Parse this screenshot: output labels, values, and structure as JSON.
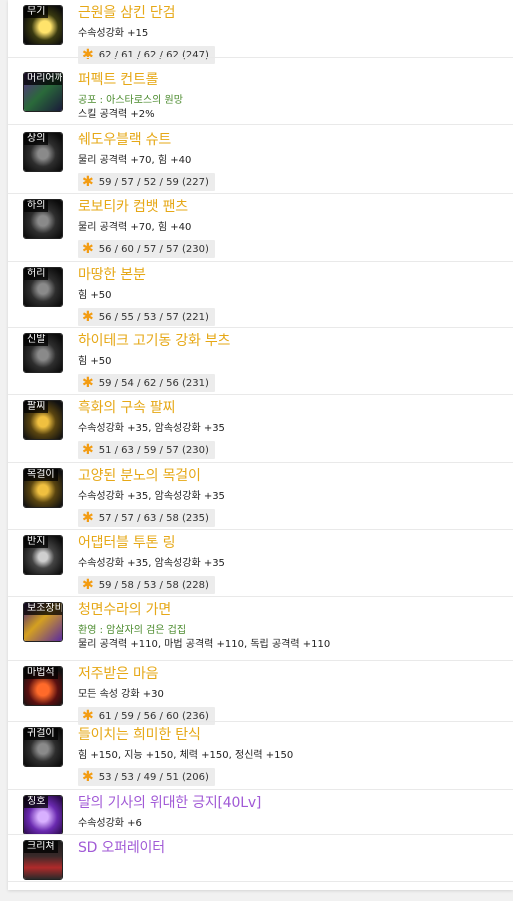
{
  "colors": {
    "title_gold": "#e6a817",
    "title_purple": "#a15ad6",
    "star": "#f39c12",
    "set_green": "#4a8a2c"
  },
  "items": [
    {
      "slot": "무기",
      "name": "근원을 삼킨 단검",
      "name_color": "gold",
      "lines": [
        {
          "text": "수속성강화 +15",
          "style": "normal"
        }
      ],
      "stats": "62 / 61 / 62 / 62 (247)",
      "icon": "dagger-icon",
      "art": "a-weapon"
    },
    {
      "slot": "머리어깨",
      "name": "퍼펙트 컨트롤",
      "name_color": "gold",
      "lines": [
        {
          "text": "공포 : 아스타로스의 원망",
          "style": "green"
        },
        {
          "text": "스킬 공격력 +2%",
          "style": "normal"
        }
      ],
      "stats": null,
      "icon": "shoulder-armor-icon",
      "art": "a-head"
    },
    {
      "slot": "상의",
      "name": "쉐도우블랙 슈트",
      "name_color": "gold",
      "lines": [
        {
          "text": "물리 공격력 +70, 힘 +40",
          "style": "normal"
        }
      ],
      "stats": "59 / 57 / 52 / 59 (227)",
      "icon": "top-armor-icon",
      "art": "a-dark"
    },
    {
      "slot": "하의",
      "name": "로보티카 컴뱃 팬츠",
      "name_color": "gold",
      "lines": [
        {
          "text": "물리 공격력 +70, 힘 +40",
          "style": "normal"
        }
      ],
      "stats": "56 / 60 / 57 / 57 (230)",
      "icon": "pants-icon",
      "art": "a-dark"
    },
    {
      "slot": "허리",
      "name": "마땅한 본분",
      "name_color": "gold",
      "lines": [
        {
          "text": "힘 +50",
          "style": "normal"
        }
      ],
      "stats": "56 / 55 / 53 / 57 (221)",
      "icon": "belt-icon",
      "art": "a-dark"
    },
    {
      "slot": "신발",
      "name": "하이테크 고기동 강화 부츠",
      "name_color": "gold",
      "lines": [
        {
          "text": "힘 +50",
          "style": "normal"
        }
      ],
      "stats": "59 / 54 / 62 / 56 (231)",
      "icon": "boots-icon",
      "art": "a-dark"
    },
    {
      "slot": "팔찌",
      "name": "흑화의 구속 팔찌",
      "name_color": "gold",
      "lines": [
        {
          "text": "수속성강화 +35, 암속성강화 +35",
          "style": "normal"
        }
      ],
      "stats": "51 / 63 / 59 / 57 (230)",
      "icon": "bracelet-icon",
      "art": "a-gold"
    },
    {
      "slot": "목걸이",
      "name": "고양된 분노의 목걸이",
      "name_color": "gold",
      "lines": [
        {
          "text": "수속성강화 +35, 암속성강화 +35",
          "style": "normal"
        }
      ],
      "stats": "57 / 57 / 63 / 58 (235)",
      "icon": "necklace-icon",
      "art": "a-gold"
    },
    {
      "slot": "반지",
      "name": "어댑터블 투톤 링",
      "name_color": "gold",
      "lines": [
        {
          "text": "수속성강화 +35, 암속성강화 +35",
          "style": "normal"
        }
      ],
      "stats": "59 / 58 / 53 / 58 (228)",
      "icon": "ring-icon",
      "art": "a-ring"
    },
    {
      "slot": "보조장비",
      "name": "청면수라의 가면",
      "name_color": "gold",
      "lines": [
        {
          "text": "환영 : 암살자의 검은 겁집",
          "style": "green"
        },
        {
          "text": "물리 공격력 +110, 마법 공격력 +110, 독립 공격력 +110",
          "style": "normal"
        }
      ],
      "stats": null,
      "icon": "mask-icon",
      "art": "a-purple"
    },
    {
      "slot": "마법석",
      "name": "저주받은 마음",
      "name_color": "gold",
      "lines": [
        {
          "text": "모든 속성 강화 +30",
          "style": "normal"
        }
      ],
      "stats": "61 / 59 / 56 / 60 (236)",
      "icon": "magic-stone-icon",
      "art": "a-red"
    },
    {
      "slot": "귀걸이",
      "name": "들이치는 희미한 탄식",
      "name_color": "gold",
      "lines": [
        {
          "text": "힘 +150, 지능 +150, 체력 +150, 정신력 +150",
          "style": "normal"
        }
      ],
      "stats": "53 / 53 / 49 / 51 (206)",
      "icon": "earring-icon",
      "art": "a-dark"
    },
    {
      "slot": "칭호",
      "name": "달의 기사의 위대한 긍지[40Lv]",
      "name_color": "purple",
      "lines": [
        {
          "text": "수속성강화 +6",
          "style": "normal"
        }
      ],
      "stats": null,
      "icon": "title-emblem-icon",
      "art": "a-violet"
    },
    {
      "slot": "크리쳐",
      "name": "SD 오퍼레이터",
      "name_color": "purple",
      "lines": [],
      "stats": null,
      "icon": "creature-icon",
      "art": "a-creature"
    }
  ]
}
